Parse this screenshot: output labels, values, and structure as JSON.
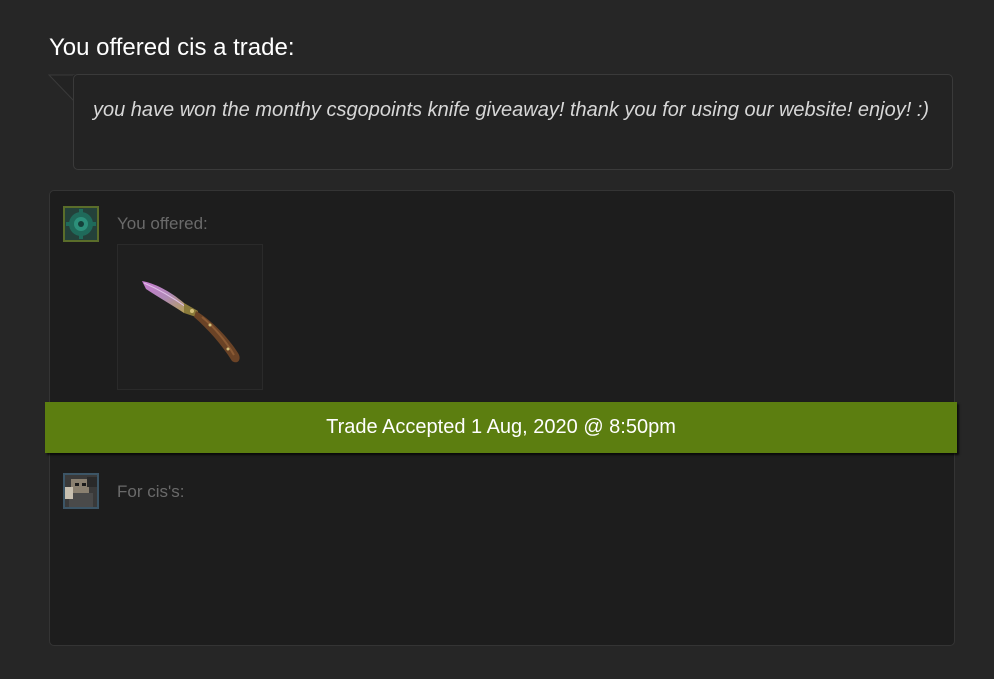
{
  "header": {
    "title": "You offered cis a trade:"
  },
  "message": {
    "text": "you have won the monthy csgopoints knife giveaway! thank you for using our website! enjoy! :)"
  },
  "trade": {
    "you_offered_label": "You offered:",
    "for_label": "For cis's:",
    "status_banner": "Trade Accepted 1 Aug, 2020 @ 8:50pm",
    "status_color": "#5c7e10",
    "offered_items": [
      {
        "icon": "knife-icon"
      }
    ]
  },
  "colors": {
    "background": "#262626",
    "panel": "#1d1d1d",
    "accent": "#5c7e10"
  }
}
